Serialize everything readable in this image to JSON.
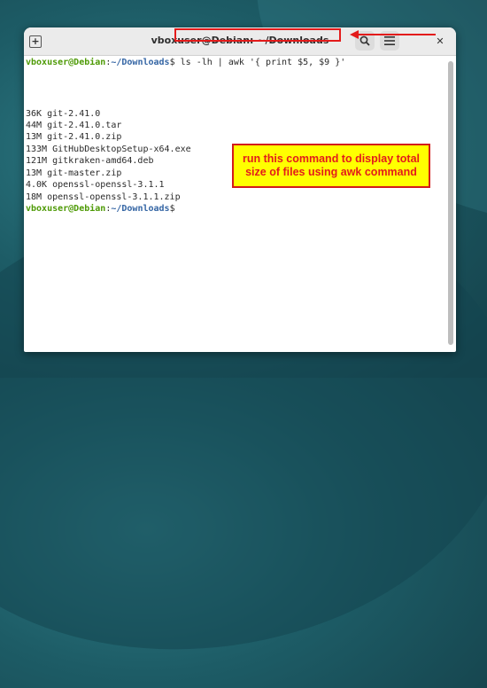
{
  "window": {
    "title": "vboxuser@Debian: ~/Downloads",
    "new_tab_icon": "plus-icon",
    "search_icon": "search-icon",
    "menu_icon": "hamburger-icon",
    "close_icon": "close-icon"
  },
  "terminal": {
    "prompt_user": "vboxuser@Debian",
    "prompt_sep": ":",
    "prompt_path": "~/Downloads",
    "prompt_symbol": "$",
    "command": " ls -lh | awk '{ print $5, $9 }'",
    "output": [
      "36K git-2.41.0",
      "44M git-2.41.0.tar",
      "13M git-2.41.0.zip",
      "133M GitHubDesktopSetup-x64.exe",
      "121M gitkraken-amd64.deb",
      "13M git-master.zip",
      "4.0K openssl-openssl-3.1.1",
      "18M openssl-openssl-3.1.1.zip"
    ]
  },
  "annotation": {
    "line1": "run this command to display total",
    "line2": "size of files using awk command",
    "color": "#e31b1b",
    "background": "#ffff00"
  }
}
